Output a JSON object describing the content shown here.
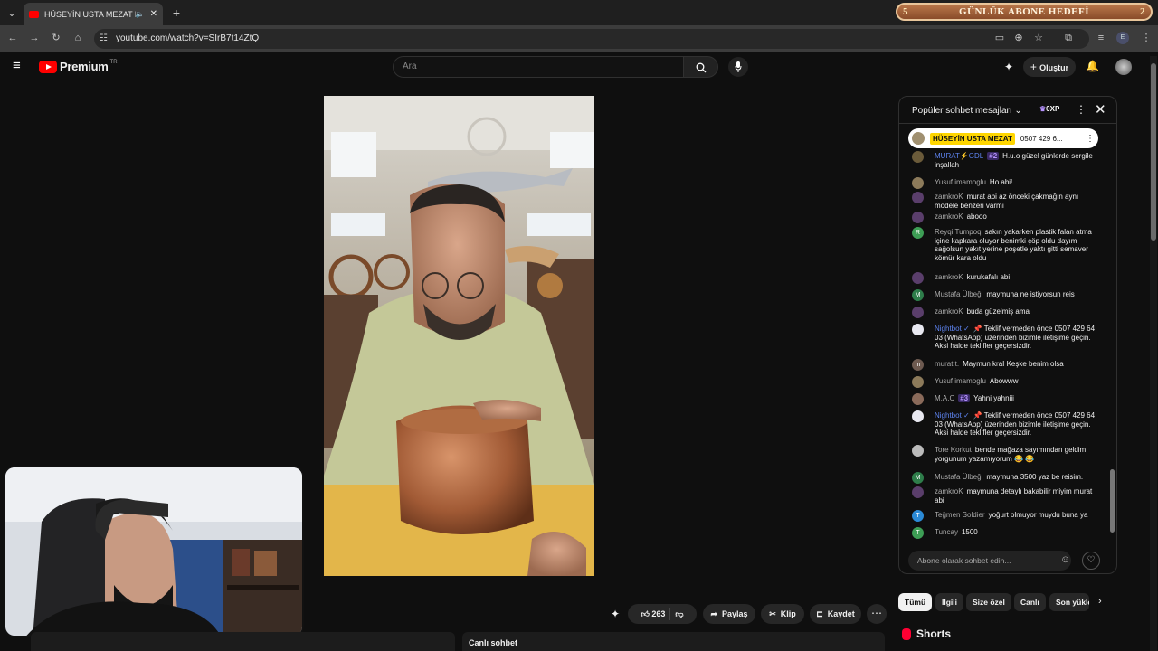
{
  "browser": {
    "tab_title": "HÜSEYİN USTA MEZAT kan",
    "url": "youtube.com/watch?v=SIrB7t14ZtQ",
    "profile_initial": "E"
  },
  "banner": {
    "left_num": "5",
    "title": "GÜNLÜK ABONE HEDEFİ",
    "right_num": "2"
  },
  "header": {
    "brand": "Premium",
    "region": "TR",
    "search_placeholder": "Ara",
    "create_label": "Oluştur"
  },
  "actions": {
    "likes": "263",
    "share": "Paylaş",
    "clip": "Klip",
    "save": "Kaydet"
  },
  "live_chat_label": "Canlı sohbet",
  "chat": {
    "title": "Popüler sohbet mesajları",
    "xp": "0XP",
    "pinned_author": "HÜSEYİN USTA MEZAT",
    "pinned_text": "0507 429 6...",
    "input_placeholder": "Abone olarak sohbet edin...",
    "messages": [
      {
        "author": "MURAT⚡GDL",
        "badge": "#2",
        "text": "H.u.o güzel günlerde sergile inşallah",
        "mod": true,
        "color": "#6b5b3a"
      },
      {
        "author": "Yusuf imamoglu",
        "text": "Ho abi!",
        "color": "#8c7a5a"
      },
      {
        "author": "zamkroK",
        "text": "murat abi az önceki çakmağın aynı modele benzeri varmı",
        "color": "#5a3e6b"
      },
      {
        "author": "zamkroK",
        "text": "abooo",
        "color": "#5a3e6b"
      },
      {
        "author": "Reyqi Tumpoq",
        "text": "sakın yakarken plastik falan atma içine kapkara oluyor benimki çöp oldu dayım sağolsun yakıt yerine poşetle yaktı gitti semaver kömür kara oldu",
        "color": "#3d9e55",
        "initial": "R"
      },
      {
        "author": "zamkroK",
        "text": "kurukafalı abi",
        "color": "#5a3e6b"
      },
      {
        "author": "Mustafa Ülbeği",
        "text": "maymuna ne istiyorsun reis",
        "color": "#2e7d4a",
        "initial": "M"
      },
      {
        "author": "zamkroK",
        "text": "buda güzelmiş ama",
        "color": "#5a3e6b"
      },
      {
        "author": "Nightbot ✓",
        "text": "📌 Teklif vermeden önce 0507 429 64 03 (WhatsApp) üzerinden bizimle iletişime geçin. Aksi halde teklifler geçersizdir.",
        "mod": true,
        "color": "#e8e8f0"
      },
      {
        "author": "murat t.",
        "text": "Maymun kraI Keşke benim olsa",
        "color": "#6d5a50",
        "initial": "m"
      },
      {
        "author": "Yusuf imamoglu",
        "text": "Abowww",
        "color": "#8c7a5a"
      },
      {
        "author": "M.A.C",
        "badge": "#3",
        "text": "Yahni yahniii",
        "color": "#8a6a5a"
      },
      {
        "author": "Nightbot ✓",
        "text": "📌 Teklif vermeden önce 0507 429 64 03 (WhatsApp) üzerinden bizimle iletişime geçin. Aksi halde teklifler geçersizdir.",
        "mod": true,
        "color": "#e8e8f0"
      },
      {
        "author": "Tore Korkut",
        "text": "bende mağaza sayımından geldim yorgunum yazamıyorum 😂 😂",
        "color": "#bbbbbb"
      },
      {
        "author": "Mustafa Ülbeği",
        "text": "maymuna 3500 yaz be reisim.",
        "color": "#2e7d4a",
        "initial": "M"
      },
      {
        "author": "zamkroK",
        "text": "maymuna detaylı bakabilir miyim murat abi",
        "color": "#5a3e6b"
      },
      {
        "author": "Teğmen Soldier",
        "text": "yoğurt olmuyor muydu buna ya",
        "color": "#2b8ad6",
        "initial": "T"
      },
      {
        "author": "Tuncay",
        "text": "1500",
        "color": "#3d9e55",
        "initial": "T"
      }
    ]
  },
  "chips": [
    "Tümü",
    "İlgili",
    "Size özel",
    "Canlı",
    "Son yükle"
  ],
  "shorts_label": "Shorts"
}
